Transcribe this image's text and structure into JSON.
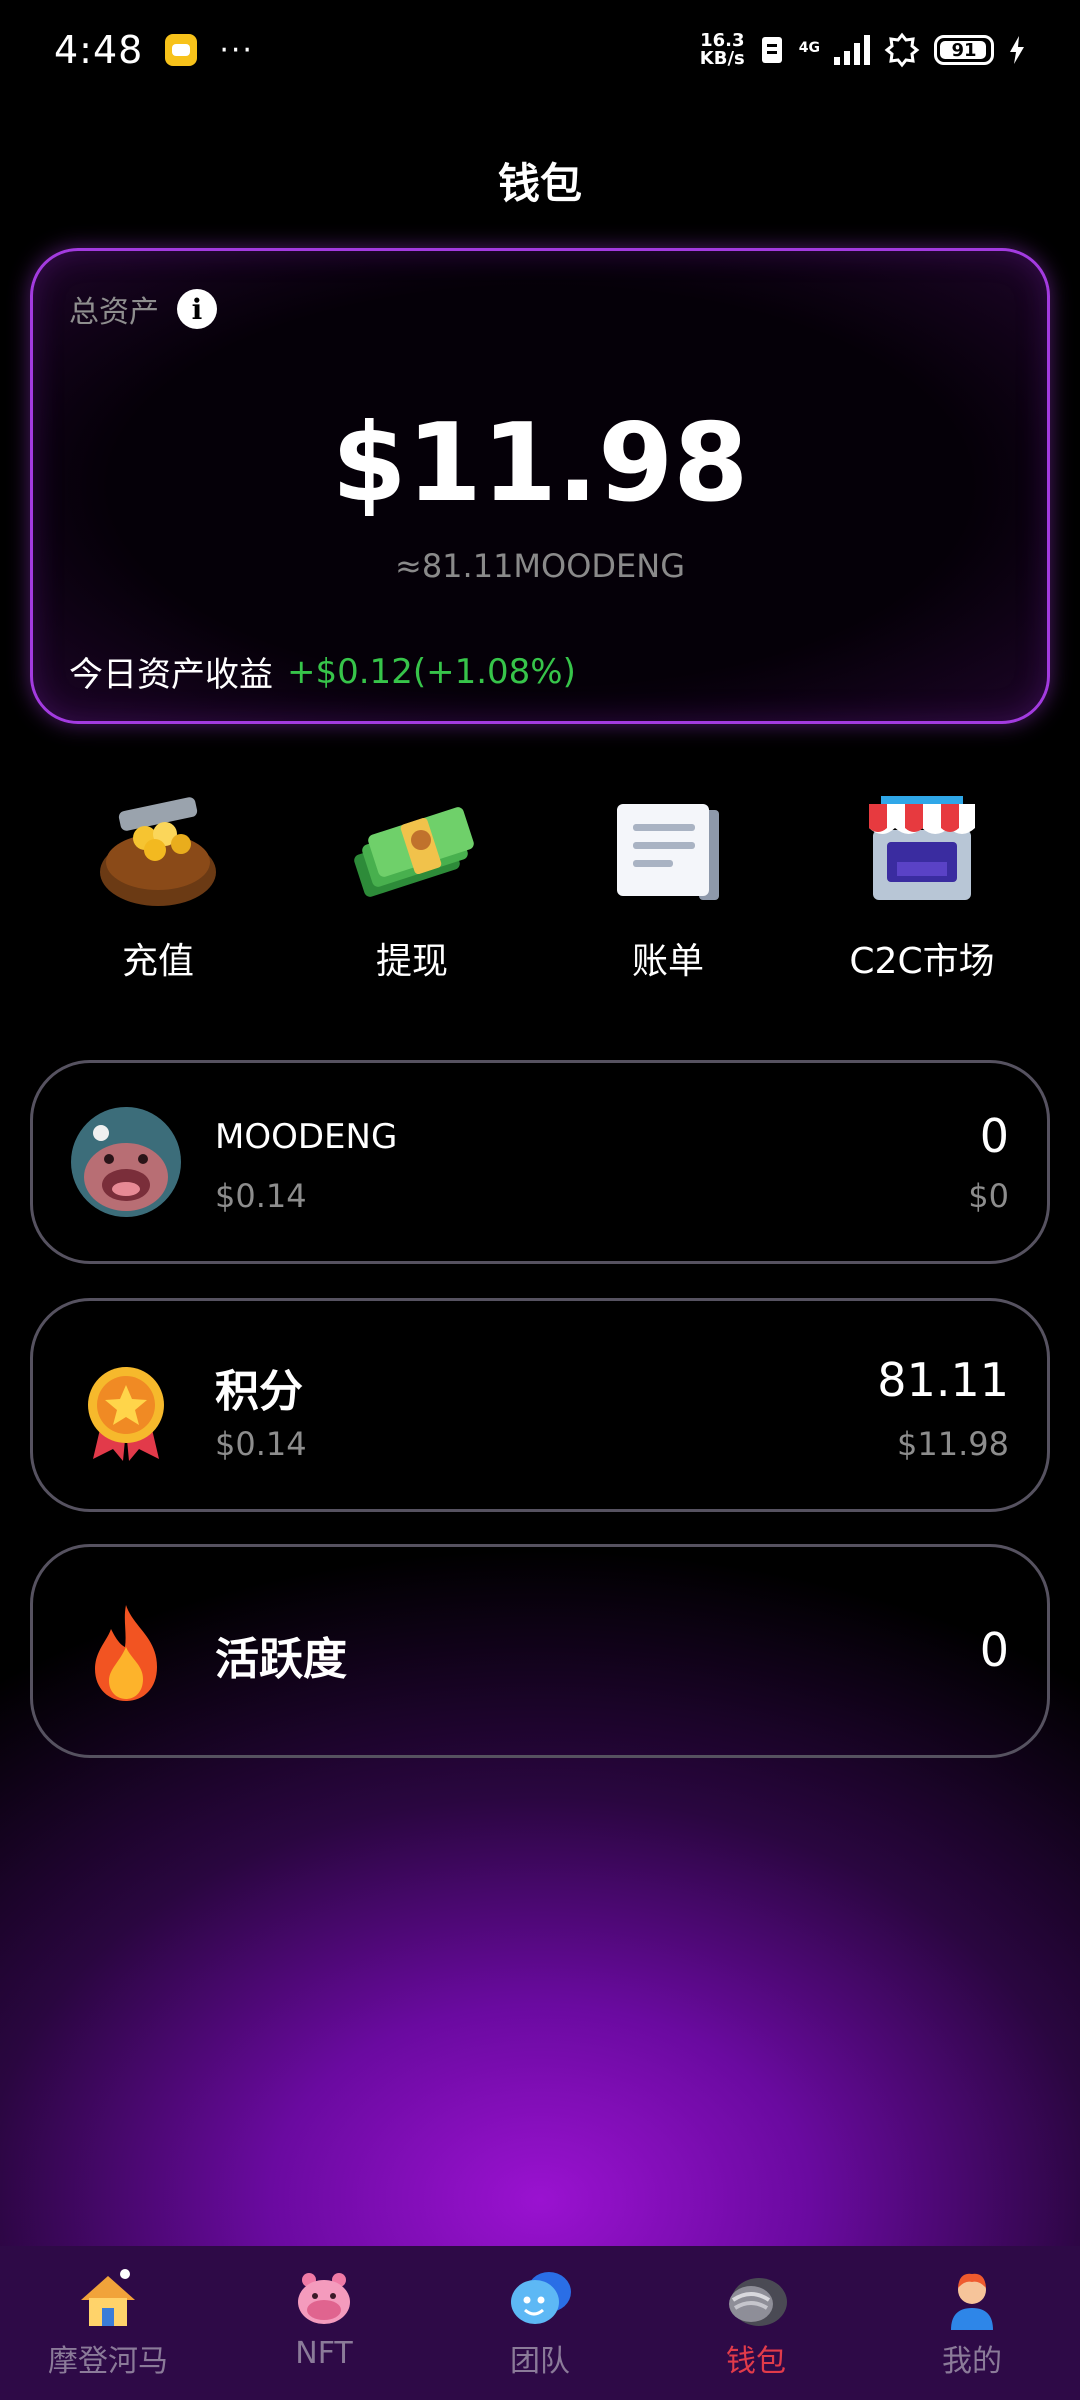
{
  "status_bar": {
    "time": "4:48",
    "dots": "···",
    "net_speed_value": "16.3",
    "net_speed_unit": "KB/s",
    "sig_tag": "4G",
    "battery": "91"
  },
  "page": {
    "title": "钱包"
  },
  "asset_card": {
    "label": "总资产",
    "info_glyph": "i",
    "amount": "$11.98",
    "equiv": "≈81.11MOODENG",
    "today_label": "今日资产收益",
    "today_value": "+$0.12(+1.08%)",
    "border_color": "#a33be0",
    "gain_color": "#37c44a"
  },
  "actions": [
    {
      "label": "充值",
      "icon": "wallet-gold-icon"
    },
    {
      "label": "提现",
      "icon": "cash-stack-icon"
    },
    {
      "label": "账单",
      "icon": "bill-icon"
    },
    {
      "label": "C2C市场",
      "icon": "market-stall-icon"
    }
  ],
  "tokens": [
    {
      "name": "MOODENG",
      "sub": "$0.14",
      "amount": "0",
      "value": "$0",
      "icon": "moodeng-avatar-icon"
    },
    {
      "name": "积分",
      "sub": "$0.14",
      "amount": "81.11",
      "value": "$11.98",
      "icon": "medal-icon"
    },
    {
      "name": "活跃度",
      "amount": "0",
      "icon": "fire-icon"
    }
  ],
  "bottom_nav": {
    "active_color": "#e23b4a",
    "items": [
      {
        "label": "摩登河马",
        "icon": "house-icon",
        "active": false
      },
      {
        "label": "NFT",
        "icon": "hippo-icon",
        "active": false
      },
      {
        "label": "团队",
        "icon": "team-icon",
        "active": false
      },
      {
        "label": "钱包",
        "icon": "wallet-icon",
        "active": true
      },
      {
        "label": "我的",
        "icon": "profile-icon",
        "active": false
      }
    ]
  }
}
